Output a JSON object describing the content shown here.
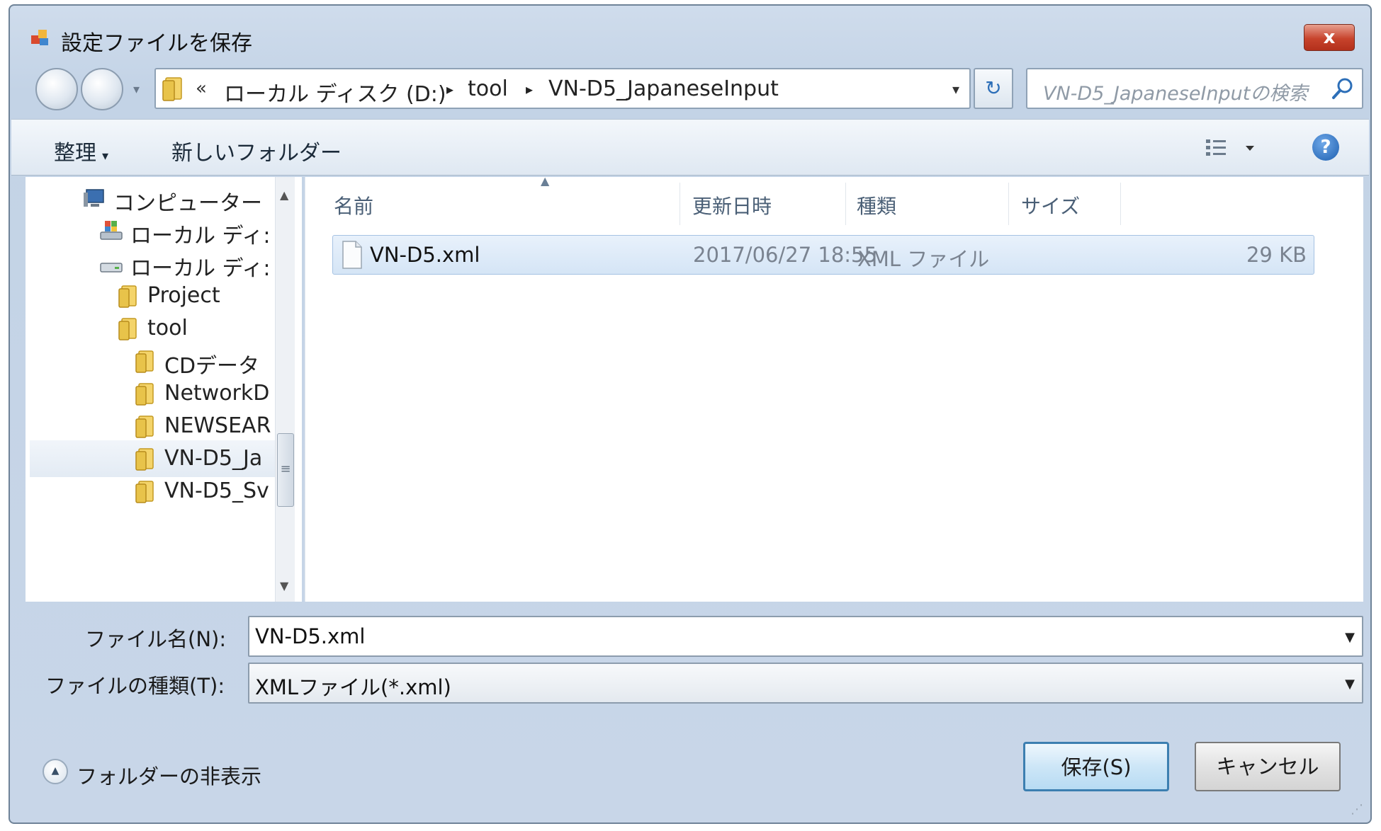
{
  "window": {
    "title": "設定ファイルを保存",
    "close_label": "x"
  },
  "address": {
    "chevron": "«",
    "crumbs": [
      "ローカル ディスク (D:)",
      "tool",
      "VN-D5_JapaneseInput"
    ],
    "crumb_separator": "▸",
    "dropdown": "▾",
    "refresh": "↻"
  },
  "search": {
    "placeholder": "VN-D5_JapaneseInputの検索"
  },
  "toolbar": {
    "organize_label": "整理",
    "new_folder_label": "新しいフォルダー",
    "caret": "▾"
  },
  "nav_tree": {
    "items": [
      {
        "label": "コンピューター",
        "icon": "computer-icon"
      },
      {
        "label": "ローカル ディ:",
        "icon": "system-drive-icon"
      },
      {
        "label": "ローカル ディ:",
        "icon": "drive-icon"
      },
      {
        "label": "Project",
        "icon": "folder-icon"
      },
      {
        "label": "tool",
        "icon": "folder-icon"
      },
      {
        "label": "CDデータ",
        "icon": "folder-icon"
      },
      {
        "label": "NetworkD",
        "icon": "folder-icon"
      },
      {
        "label": "NEWSEAR",
        "icon": "folder-icon"
      },
      {
        "label": "VN-D5_Ja",
        "icon": "folder-icon"
      },
      {
        "label": "VN-D5_Sv",
        "icon": "folder-icon"
      }
    ]
  },
  "file_list": {
    "columns": [
      "名前",
      "更新日時",
      "種類",
      "サイズ"
    ],
    "rows": [
      {
        "name": "VN-D5.xml",
        "modified": "2017/06/27 18:55",
        "type": "XML ファイル",
        "size": "29 KB"
      }
    ]
  },
  "form": {
    "filename_label": "ファイル名(N):",
    "filename_value": "VN-D5.xml",
    "filetype_label": "ファイルの種類(T):",
    "filetype_value": "XMLファイル(*.xml)",
    "hide_folders_label": "フォルダーの非表示",
    "save_label": "保存(S)",
    "cancel_label": "キャンセル"
  },
  "colors": {
    "folder": "#e8c34a",
    "accent": "#3c7fb1",
    "selection": "#d5e5f6"
  }
}
